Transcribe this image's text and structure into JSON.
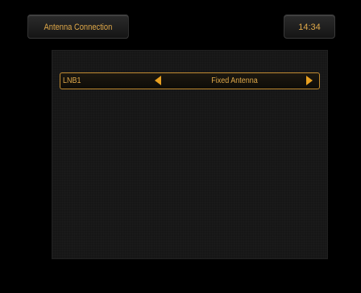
{
  "header": {
    "title": "Antenna Connection",
    "clock": "14:34"
  },
  "settings": {
    "rows": [
      {
        "label": "LNB1",
        "value": "Fixed Antenna"
      }
    ]
  },
  "colors": {
    "accent": "#e0a94a",
    "arrow": "#e8a020",
    "background": "#000000",
    "panel": "#161616"
  }
}
